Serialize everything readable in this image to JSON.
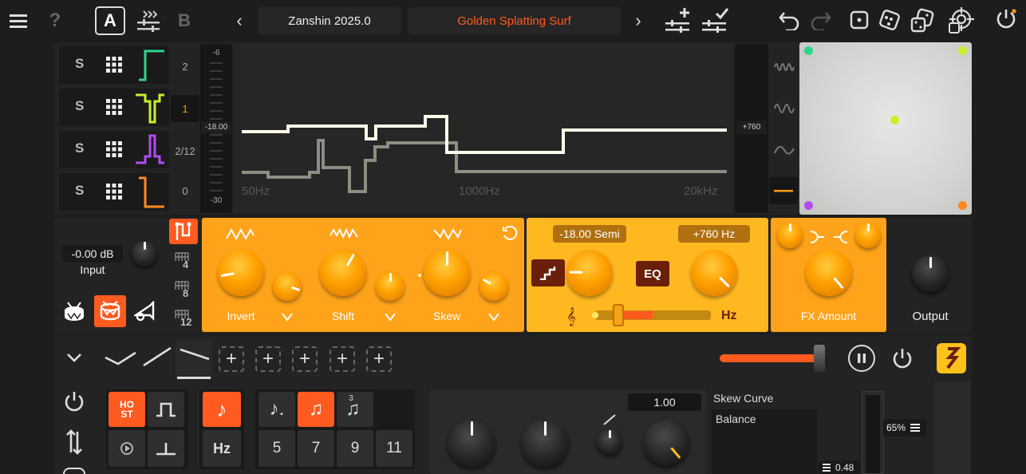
{
  "topbar": {
    "ab_a": "A",
    "ab_b": "B",
    "bank_name": "Zanshin 2025.0",
    "preset_name": "Golden Splatting Surf",
    "prev": "‹",
    "next": "›"
  },
  "bands": {
    "solo": [
      "S",
      "S",
      "S",
      "S"
    ],
    "octave_labels": [
      "2",
      "1",
      "2/12",
      "0"
    ],
    "active_octave": "1",
    "octave_active_color": "#ff9d00"
  },
  "eq": {
    "scale": [
      "-6",
      "-18.00",
      "-30"
    ],
    "freq_labels": [
      "50Hz",
      "1000Hz",
      "20kHz"
    ],
    "readout": "+760"
  },
  "input": {
    "value": "-0.00 dB",
    "label": "Input"
  },
  "division_labels": [
    "4",
    "8",
    "12"
  ],
  "fx1": {
    "labels": [
      "Invert",
      "Shift",
      "Skew"
    ]
  },
  "fx2": {
    "semi": "-18.00 Semi",
    "hz": "+760 Hz",
    "eq_btn": "EQ",
    "hz_label": "Hz"
  },
  "fx3": {
    "label": "FX Amount"
  },
  "output": {
    "label": "Output"
  },
  "mod": {
    "host_btn": "HO\nST",
    "hz_btn": "Hz",
    "rates": [
      "5",
      "7",
      "9",
      "11"
    ],
    "value": "1.00",
    "curve_title": "Skew Curve",
    "curve_item": "Balance",
    "percent": "65%",
    "slider_val": "0.48"
  },
  "colors": {
    "accent_orange": "#ff5a1f",
    "panel_orange": "#ffa31a",
    "curve_light": "#fffde9",
    "curve_dark": "#8d8d82"
  }
}
